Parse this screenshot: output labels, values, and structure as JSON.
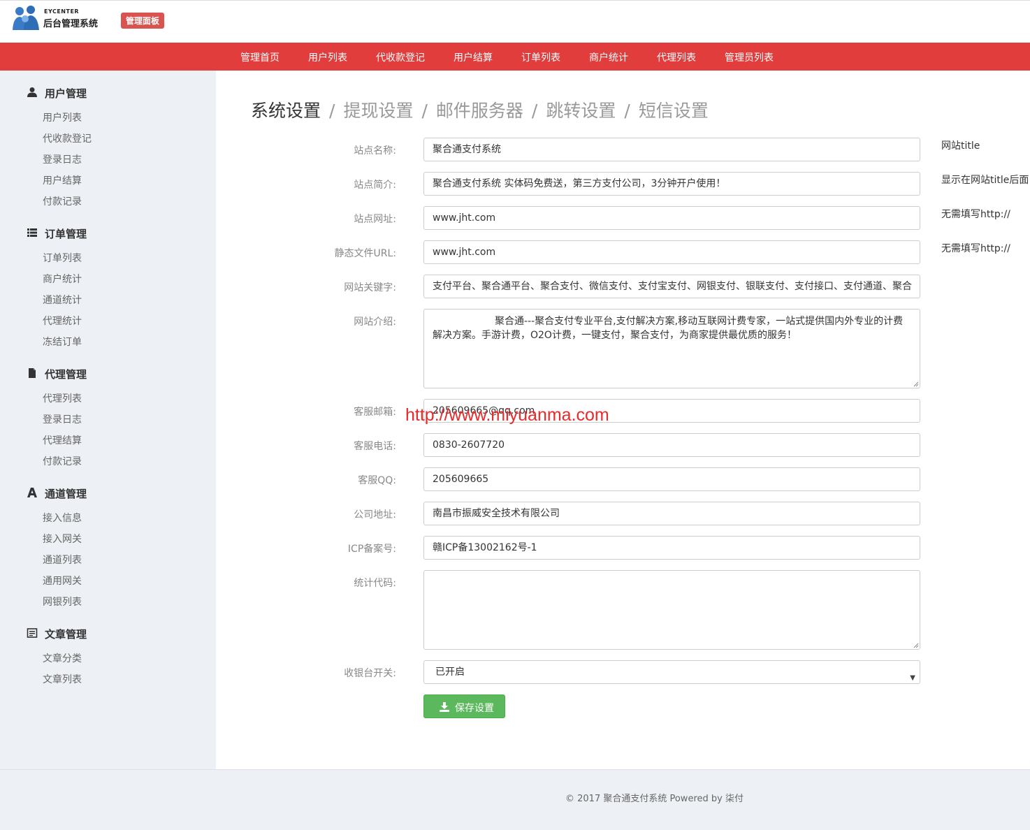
{
  "header": {
    "brand_small": "EYCENTER",
    "brand_main": "后台管理系统",
    "badge": "管理面板"
  },
  "topnav": [
    "管理首页",
    "用户列表",
    "代收款登记",
    "用户结算",
    "订单列表",
    "商户统计",
    "代理列表",
    "管理员列表"
  ],
  "sidebar": {
    "groups": [
      {
        "title": "用户管理",
        "icon": "user-icon",
        "items": [
          "用户列表",
          "代收款登记",
          "登录日志",
          "用户结算",
          "付款记录"
        ]
      },
      {
        "title": "订单管理",
        "icon": "list-icon",
        "items": [
          "订单列表",
          "商户统计",
          "通道统计",
          "代理统计",
          "冻结订单"
        ]
      },
      {
        "title": "代理管理",
        "icon": "file-icon",
        "items": [
          "代理列表",
          "登录日志",
          "代理结算",
          "付款记录"
        ]
      },
      {
        "title": "通道管理",
        "icon": "font-icon",
        "items": [
          "接入信息",
          "接入网关",
          "通道列表",
          "通用网关",
          "网银列表"
        ]
      },
      {
        "title": "文章管理",
        "icon": "article-icon",
        "items": [
          "文章分类",
          "文章列表"
        ]
      }
    ]
  },
  "breadcrumb": {
    "active": "系统设置",
    "links": [
      "提现设置",
      "邮件服务器",
      "跳转设置",
      "短信设置"
    ],
    "separator": "/"
  },
  "form": {
    "site_name": {
      "label": "站点名称:",
      "value": "聚合通支付系统",
      "hint": "网站title"
    },
    "site_desc": {
      "label": "站点简介:",
      "value": "聚合通支付系统  实体码免费送，第三方支付公司，3分钟开户使用！",
      "hint": "显示在网站title后面"
    },
    "site_url": {
      "label": "站点网址:",
      "value": "www.jht.com",
      "hint": "无需填写http://"
    },
    "static_url": {
      "label": "静态文件URL:",
      "value": "www.jht.com",
      "hint": "无需填写http://"
    },
    "keywords": {
      "label": "网站关键字:",
      "value": "支付平台、聚合通平台、聚合支付、微信支付、支付宝支付、网银支付、银联支付、支付接口、支付通道、聚合"
    },
    "intro": {
      "label": "网站介绍:",
      "value": "                    聚合通---聚合支付专业平台,支付解决方案,移动互联网计费专家，一站式提供国内外专业的计费解决方案。手游计费，O2O计费，一键支付，聚合支付，为商家提供最优质的服务！"
    },
    "email": {
      "label": "客服邮箱:",
      "value": "205609665@qq.com"
    },
    "phone": {
      "label": "客服电话:",
      "value": "0830-2607720"
    },
    "qq": {
      "label": "客服QQ:",
      "value": "205609665"
    },
    "address": {
      "label": "公司地址:",
      "value": "南昌市振威安全技术有限公司"
    },
    "icp": {
      "label": "ICP备案号:",
      "value": "赣ICP备13002162号-1"
    },
    "stats_code": {
      "label": "统计代码:",
      "value": ""
    },
    "cashier": {
      "label": "收银台开关:",
      "value": "已开启"
    },
    "save_label": "保存设置"
  },
  "watermark": "http://www.miyuanma.com",
  "footer": "© 2017  聚合通支付系统 Powered by 柒付",
  "colors": {
    "nav": "#e13d3d",
    "badge": "#d9534f",
    "save": "#5cb85c",
    "sidebar": "#edf0f4",
    "watermark": "#e82a2a"
  }
}
